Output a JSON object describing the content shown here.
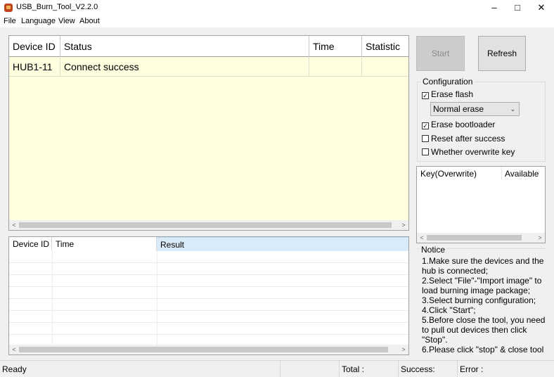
{
  "window": {
    "title": "USB_Burn_Tool_V2.2.0",
    "minimize": "–",
    "maximize": "□",
    "close": "✕"
  },
  "menu": [
    "File",
    "Language",
    "View",
    "About"
  ],
  "device_table": {
    "columns": [
      "Device ID",
      "Status",
      "Time",
      "Statistic"
    ],
    "rows": [
      {
        "device_id": "HUB1-11",
        "status": "Connect success",
        "time": "",
        "statistic": ""
      }
    ],
    "row_color": "#ffffe0"
  },
  "log_table": {
    "columns": [
      "Device ID",
      "Time",
      "Result"
    ]
  },
  "buttons": {
    "start": "Start",
    "refresh": "Refresh"
  },
  "configuration": {
    "title": "Configuration",
    "erase_flash": {
      "label": "Erase flash",
      "checked": true
    },
    "erase_mode": "Normal erase",
    "erase_bootloader": {
      "label": "Erase bootloader",
      "checked": true
    },
    "reset_after_success": {
      "label": "Reset after success",
      "checked": false
    },
    "overwrite_key": {
      "label": "Whether overwrite key",
      "checked": false
    }
  },
  "key_table": {
    "columns": [
      "Key(Overwrite)",
      "Available"
    ]
  },
  "notice": {
    "title": "Notice",
    "lines": [
      "1.Make sure the devices and the hub is connected;",
      "2.Select \"File\"-\"Import image\" to load burning image package;",
      "3.Select burning configuration;",
      "4.Click \"Start\";",
      "5.Before close the tool, you need to pull out devices then click \"Stop\".",
      "6.Please click \"stop\" & close tool"
    ]
  },
  "status_bar": {
    "state": "Ready",
    "total": "Total :",
    "success": "Success:",
    "error": "Error :"
  }
}
